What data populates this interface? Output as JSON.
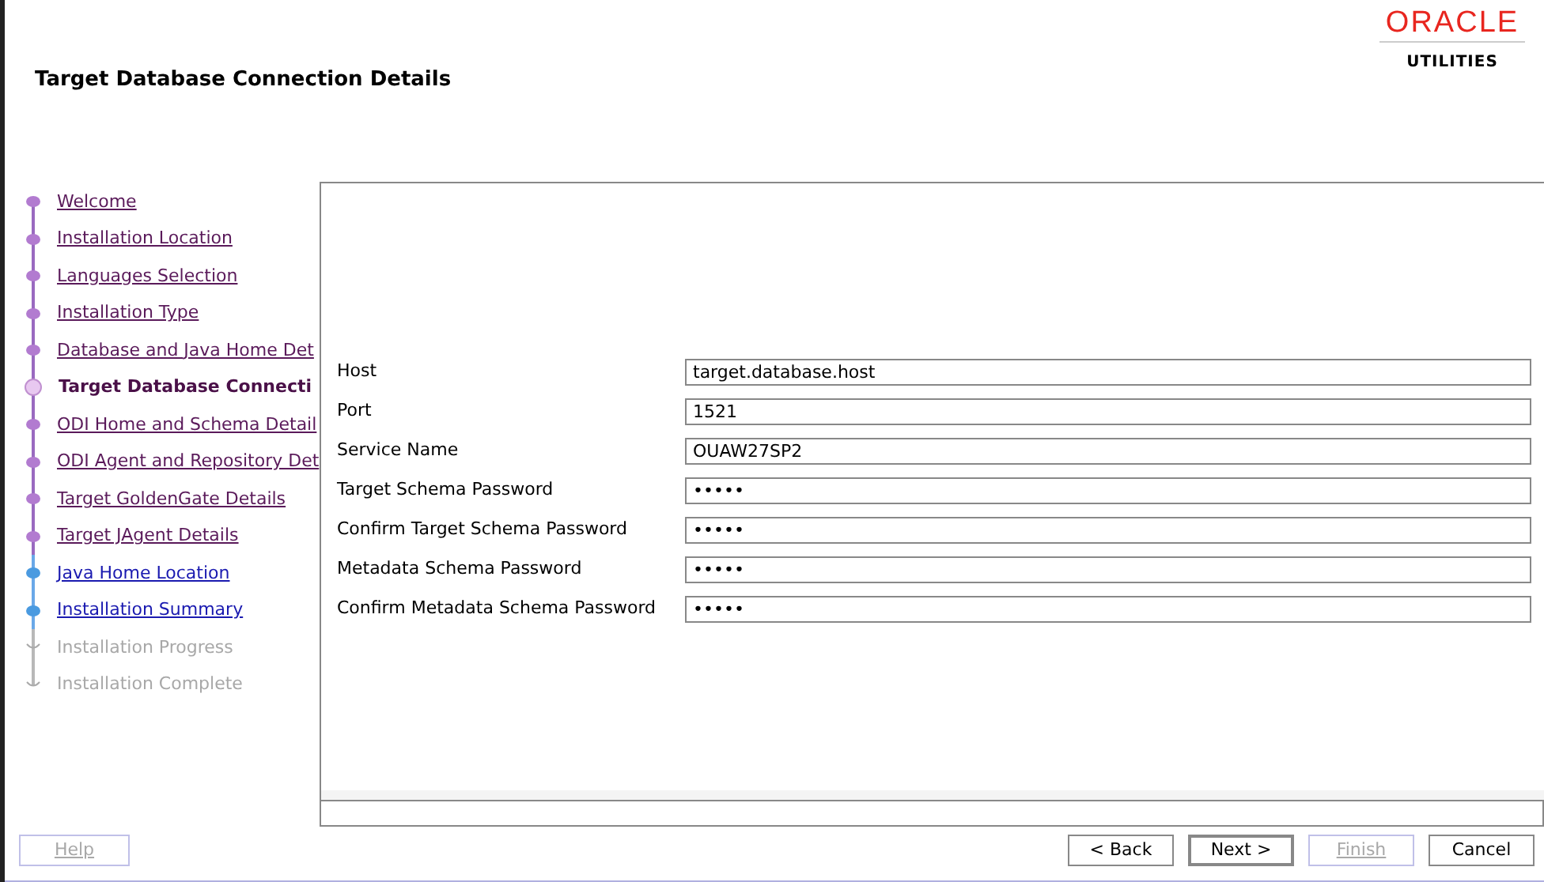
{
  "header": {
    "title": "Target Database Connection Details",
    "logo": {
      "brand": "ORACLE",
      "product": "UTILITIES"
    }
  },
  "steps": [
    {
      "label": "Welcome",
      "kind": "visited"
    },
    {
      "label": "Installation Location",
      "kind": "visited"
    },
    {
      "label": "Languages Selection",
      "kind": "visited"
    },
    {
      "label": "Installation Type",
      "kind": "visited"
    },
    {
      "label": "Database and Java Home Det",
      "kind": "visited"
    },
    {
      "label": "Target Database Connecti",
      "kind": "current"
    },
    {
      "label": "ODI Home and Schema Detail",
      "kind": "visited"
    },
    {
      "label": "ODI Agent and Repository Det",
      "kind": "visited"
    },
    {
      "label": "Target GoldenGate Details",
      "kind": "visited"
    },
    {
      "label": "Target JAgent Details",
      "kind": "visited"
    },
    {
      "label": "Java Home Location",
      "kind": "available"
    },
    {
      "label": "Installation Summary",
      "kind": "available"
    },
    {
      "label": "Installation Progress",
      "kind": "disabled"
    },
    {
      "label": "Installation Complete",
      "kind": "disabled"
    }
  ],
  "form": [
    {
      "label": "Host",
      "value": "target.database.host"
    },
    {
      "label": "Port",
      "value": "1521"
    },
    {
      "label": "Service Name",
      "value": "OUAW27SP2"
    },
    {
      "label": "Target Schema Password",
      "value": "•••••"
    },
    {
      "label": "Confirm Target Schema Password",
      "value": "•••••"
    },
    {
      "label": "Metadata Schema Password",
      "value": "•••••"
    },
    {
      "label": "Confirm Metadata Schema Password",
      "value": "•••••"
    }
  ],
  "buttons_left": [
    {
      "label": "Help",
      "disabled": true,
      "default": false
    }
  ],
  "buttons_right": [
    {
      "label": "< Back",
      "disabled": false,
      "default": false
    },
    {
      "label": "Next >",
      "disabled": false,
      "default": true
    },
    {
      "label": "Finish",
      "disabled": true,
      "default": false
    },
    {
      "label": "Cancel",
      "disabled": false,
      "default": false
    }
  ]
}
